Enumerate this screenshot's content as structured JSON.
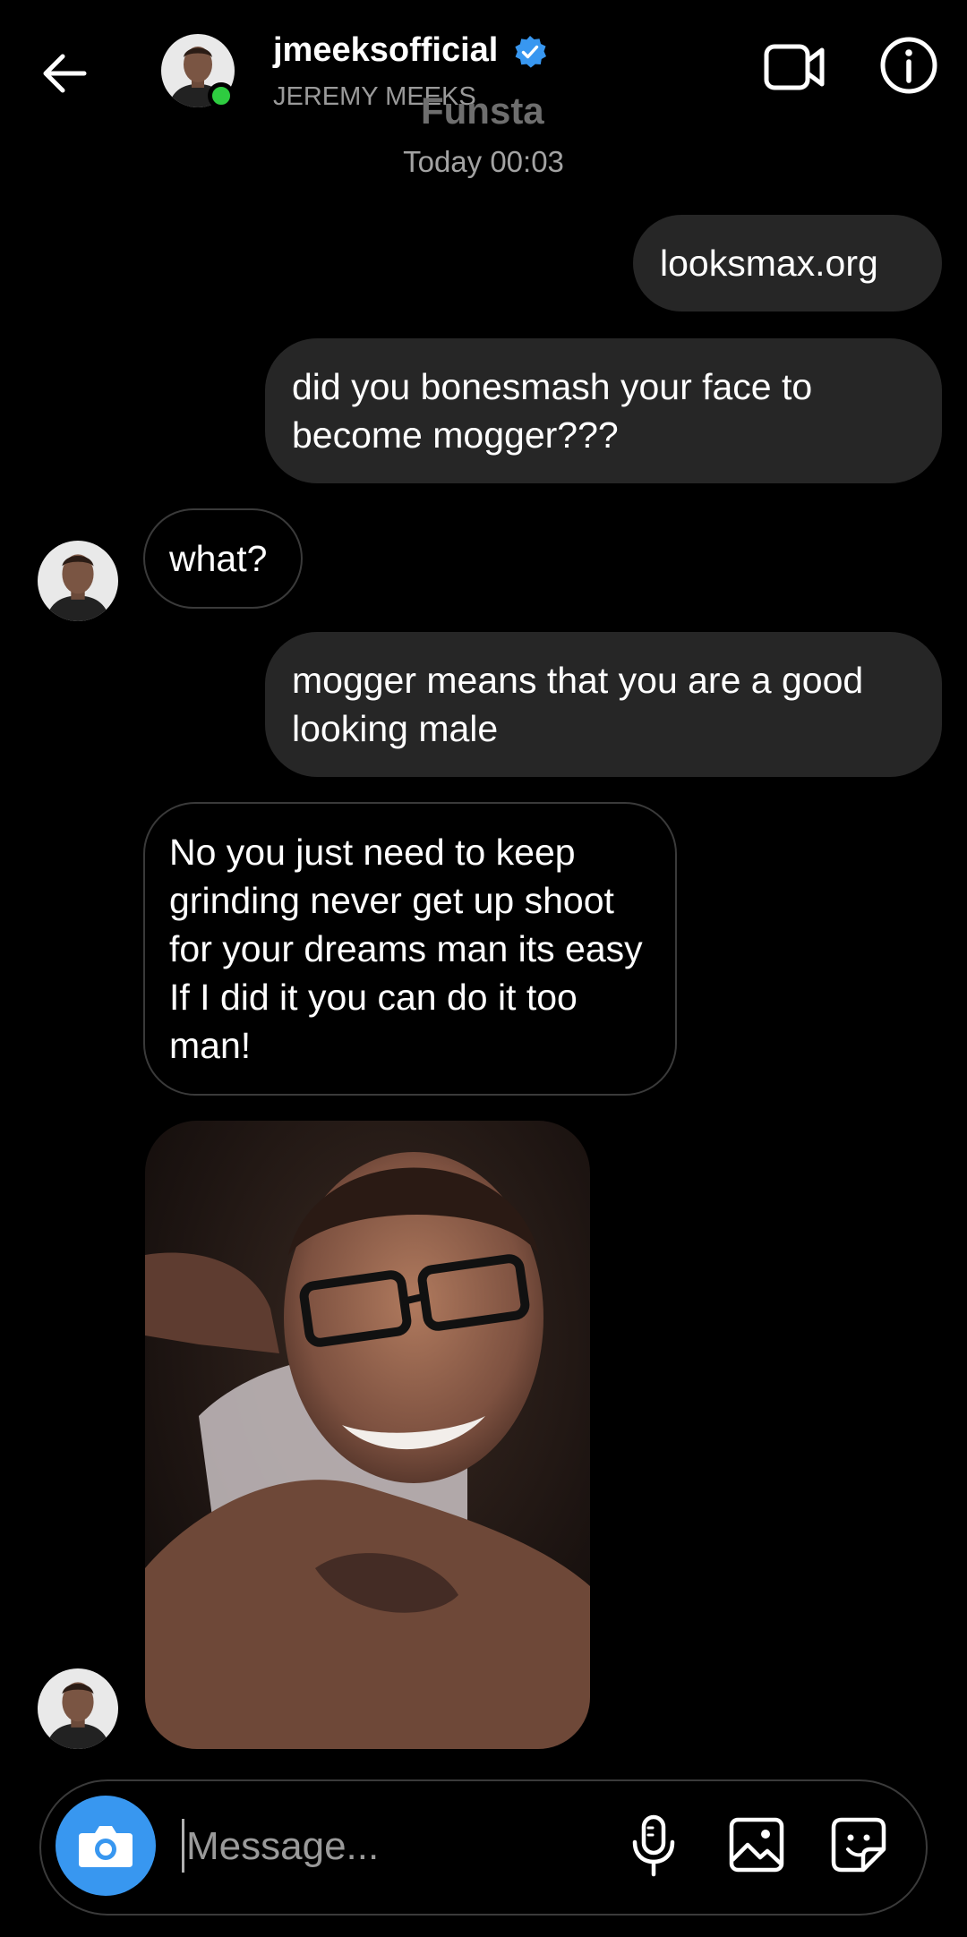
{
  "header": {
    "username": "jmeeksofficial",
    "full_name": "JEREMY MEEKS",
    "overlay_label": "Funsta",
    "icons": {
      "back": "back-arrow-icon",
      "verified": "verified-badge-icon",
      "video": "video-call-icon",
      "info": "info-icon"
    },
    "online_color": "#2ecc40",
    "verified_color": "#3897f0"
  },
  "thread": {
    "timestamp": "Today 00:03",
    "messages": [
      {
        "from": "me",
        "text": "looksmax.org"
      },
      {
        "from": "me",
        "text": "did you bonesmash your face to become mogger???"
      },
      {
        "from": "them",
        "text": "what?"
      },
      {
        "from": "me",
        "text": "mogger means that you are a good looking male"
      },
      {
        "from": "them",
        "text": "No you just need to keep grinding never get up shoot for your dreams man its easy If I did it you can do it too man!"
      },
      {
        "from": "them",
        "type": "photo"
      }
    ]
  },
  "composer": {
    "placeholder": "Message...",
    "icons": {
      "camera": "camera-icon",
      "mic": "microphone-icon",
      "gallery": "gallery-icon",
      "sticker": "sticker-icon"
    },
    "camera_color": "#3897f0"
  }
}
